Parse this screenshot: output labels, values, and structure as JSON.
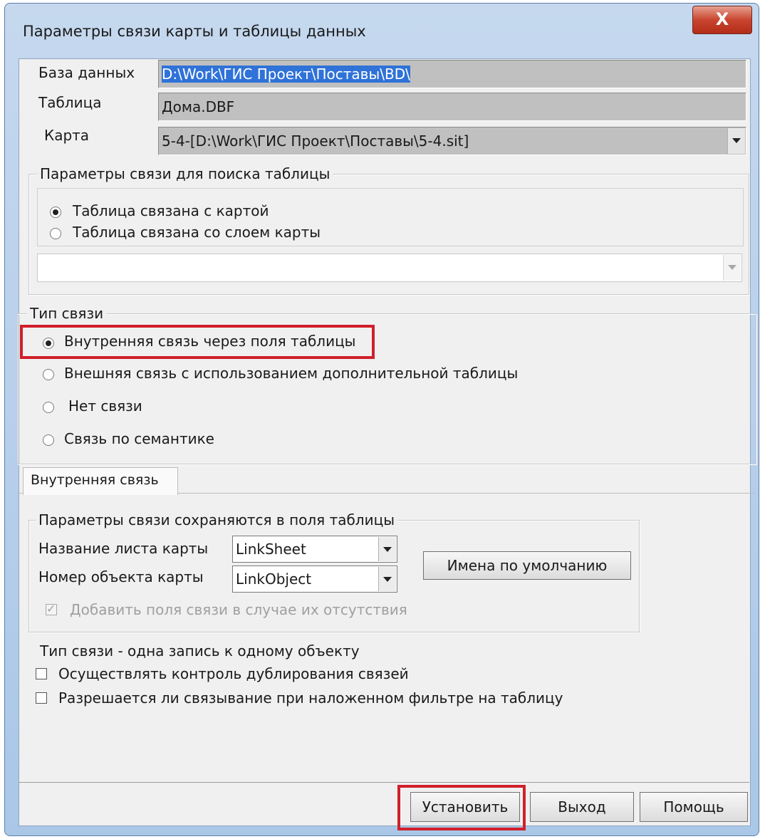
{
  "window": {
    "title": "Параметры связи карты и таблицы данных",
    "close_symbol": "X"
  },
  "database": {
    "label": "База данных",
    "value": "D:\\Work\\ГИС Проект\\Поставы\\BD\\"
  },
  "table": {
    "label": "Таблица",
    "value": "Дома.DBF"
  },
  "map": {
    "label": "Карта",
    "value": "5-4-[D:\\Work\\ГИС Проект\\Поставы\\5-4.sit]"
  },
  "search_params": {
    "title": "Параметры связи для поиска таблицы",
    "options": [
      "Таблица связана с картой",
      "Таблица связана со слоем карты"
    ],
    "selected_index": 0,
    "layer_combo_value": ""
  },
  "link_type": {
    "title": "Тип связи",
    "options": [
      "Внутренняя связь через поля таблицы",
      "Внешняя связь с использованием дополнительной таблицы",
      "Нет связи",
      "Связь по семантике"
    ],
    "selected_index": 0
  },
  "tab": {
    "label": "Внутренняя связь"
  },
  "fields_group": {
    "title": "Параметры связи сохраняются в поля таблицы",
    "sheet_label": "Название листа карты",
    "sheet_value": "LinkSheet",
    "object_label": "Номер  объекта карты",
    "object_value": "LinkObject",
    "defaults_button": "Имена по умолчанию",
    "add_fields_checkbox": "Добавить поля связи в случае их отсутствия",
    "add_fields_checked": true
  },
  "relation_note": "Тип связи - одна запись к одному объекту",
  "checkboxes": [
    {
      "label": "Осуществлять контроль дублирования связей",
      "checked": false
    },
    {
      "label": "Разрешается ли связывание при наложенном фильтре на таблицу",
      "checked": false
    }
  ],
  "buttons": {
    "set": "Установить",
    "exit": "Выход",
    "help": "Помощь"
  },
  "colors": {
    "highlight": "#d0202a",
    "selection": "#2f72d8"
  }
}
